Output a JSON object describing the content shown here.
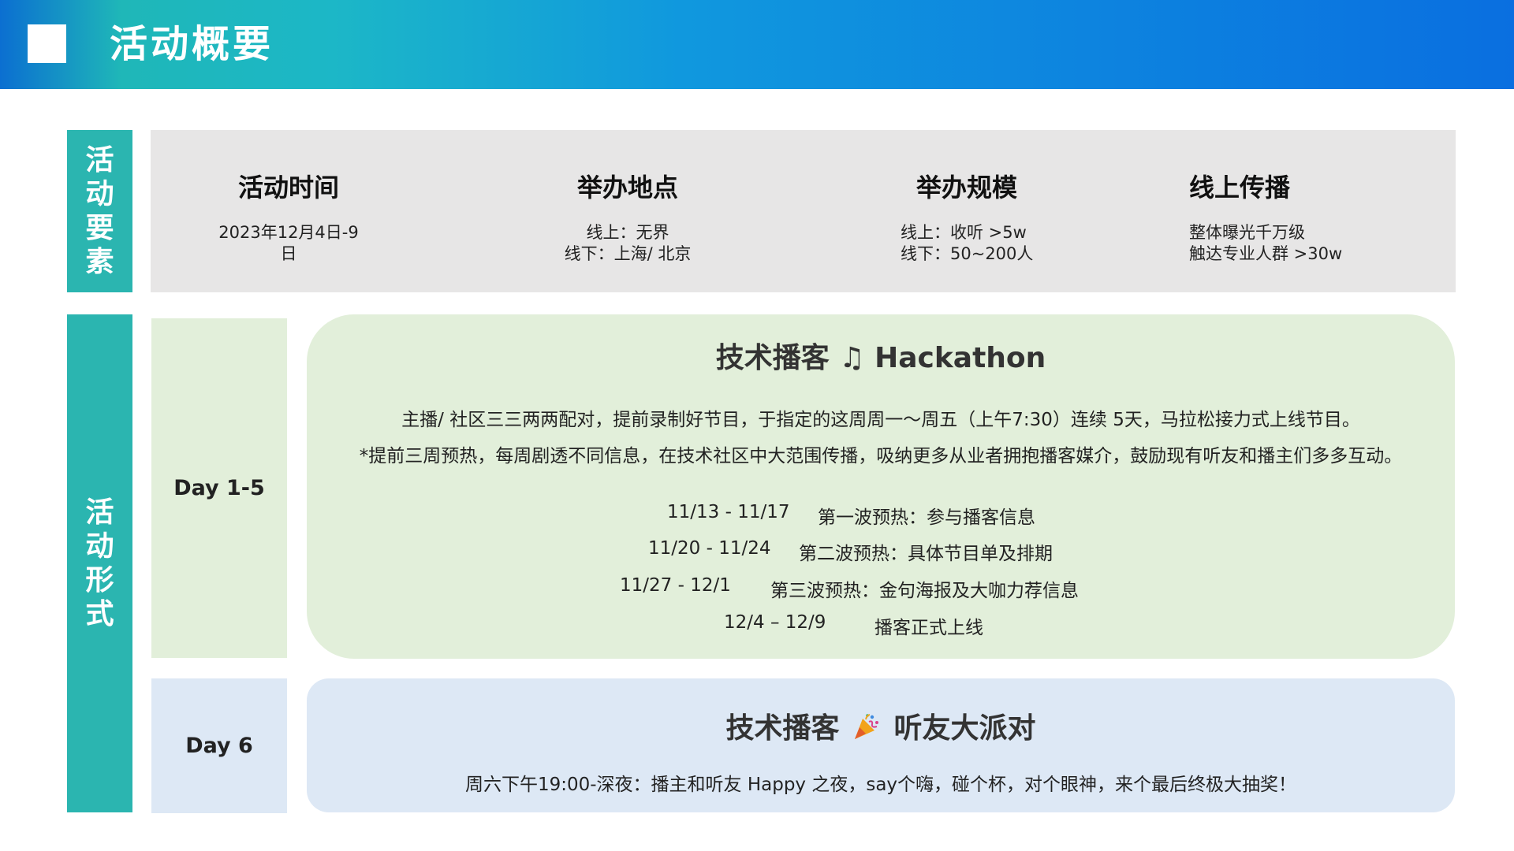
{
  "header": {
    "title": "活动概要"
  },
  "side": {
    "elements_label": "活动要素",
    "format_label": "活动形式"
  },
  "elements": [
    {
      "title": "活动时间",
      "lines": [
        "2023年12月4日-9",
        "日"
      ]
    },
    {
      "title": "举办地点",
      "lines": [
        "线上：无界",
        "线下：上海/ 北京"
      ]
    },
    {
      "title": "举办规模",
      "lines": [
        "线上：收听 >5w",
        "线下：50~200人"
      ]
    },
    {
      "title": "线上传播",
      "lines": [
        "整体曝光千万级",
        "触达专业人群 >30w"
      ]
    }
  ],
  "day1": {
    "label": "Day 1-5",
    "title_pre": "技术播客",
    "title_icon": "♫",
    "title_post": "Hackathon",
    "desc1": "主播/ 社区三三两两配对，提前录制好节目，于指定的这周周一～周五（上午7:30）连续 5天，马拉松接力式上线节目。",
    "desc2": "*提前三周预热，每周剧透不同信息，在技术社区中大范围传播，吸纳更多从业者拥抱播客媒介，鼓励现有听友和播主们多多互动。",
    "schedule": [
      {
        "date": "11/13 - 11/17",
        "desc": "第一波预热：参与播客信息"
      },
      {
        "date": "11/20 - 11/24",
        "desc": "第二波预热：具体节目单及排期"
      },
      {
        "date": "11/27 - 12/1",
        "desc": "第三波预热：金句海报及大咖力荐信息"
      },
      {
        "date": "12/4 – 12/9",
        "desc": "播客正式上线"
      }
    ]
  },
  "day6": {
    "label": "Day 6",
    "title_pre": "技术播客",
    "title_icon": "party-popper-icon",
    "title_post": "听友大派对",
    "desc": "周六下午19:00-深夜：播主和听友 Happy 之夜，say个嗨，碰个杯，对个眼神，来个最后终极大抽奖！"
  }
}
